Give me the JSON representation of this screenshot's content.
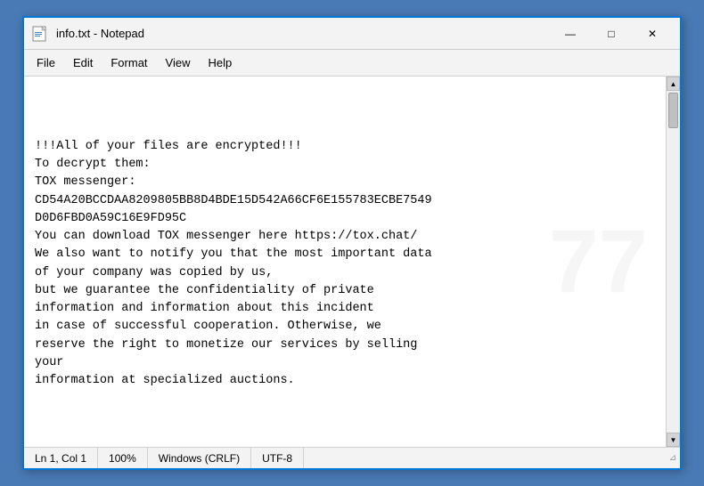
{
  "window": {
    "title": "info.txt - Notepad",
    "icon": "notepad"
  },
  "titlebar": {
    "title": "info.txt - Notepad",
    "minimize_label": "—",
    "maximize_label": "□",
    "close_label": "✕"
  },
  "menubar": {
    "items": [
      {
        "label": "File",
        "id": "file"
      },
      {
        "label": "Edit",
        "id": "edit"
      },
      {
        "label": "Format",
        "id": "format"
      },
      {
        "label": "View",
        "id": "view"
      },
      {
        "label": "Help",
        "id": "help"
      }
    ]
  },
  "content": {
    "text": "!!!All of your files are encrypted!!!\nTo decrypt them:\nTOX messenger:\nCD54A20BCCDAA8209805BB8D4BDE15D542A66CF6E155783ECBE7549\nD0D6FBD0A59C16E9FD95C\nYou can download TOX messenger here https://tox.chat/\nWe also want to notify you that the most important data\nof your company was copied by us,\nbut we guarantee the confidentiality of private\ninformation and information about this incident\nin case of successful cooperation. Otherwise, we\nreserve the right to monetize our services by selling\nyour\ninformation at specialized auctions."
  },
  "statusbar": {
    "position": "Ln 1, Col 1",
    "zoom": "100%",
    "line_endings": "Windows (CRLF)",
    "encoding": "UTF-8"
  }
}
